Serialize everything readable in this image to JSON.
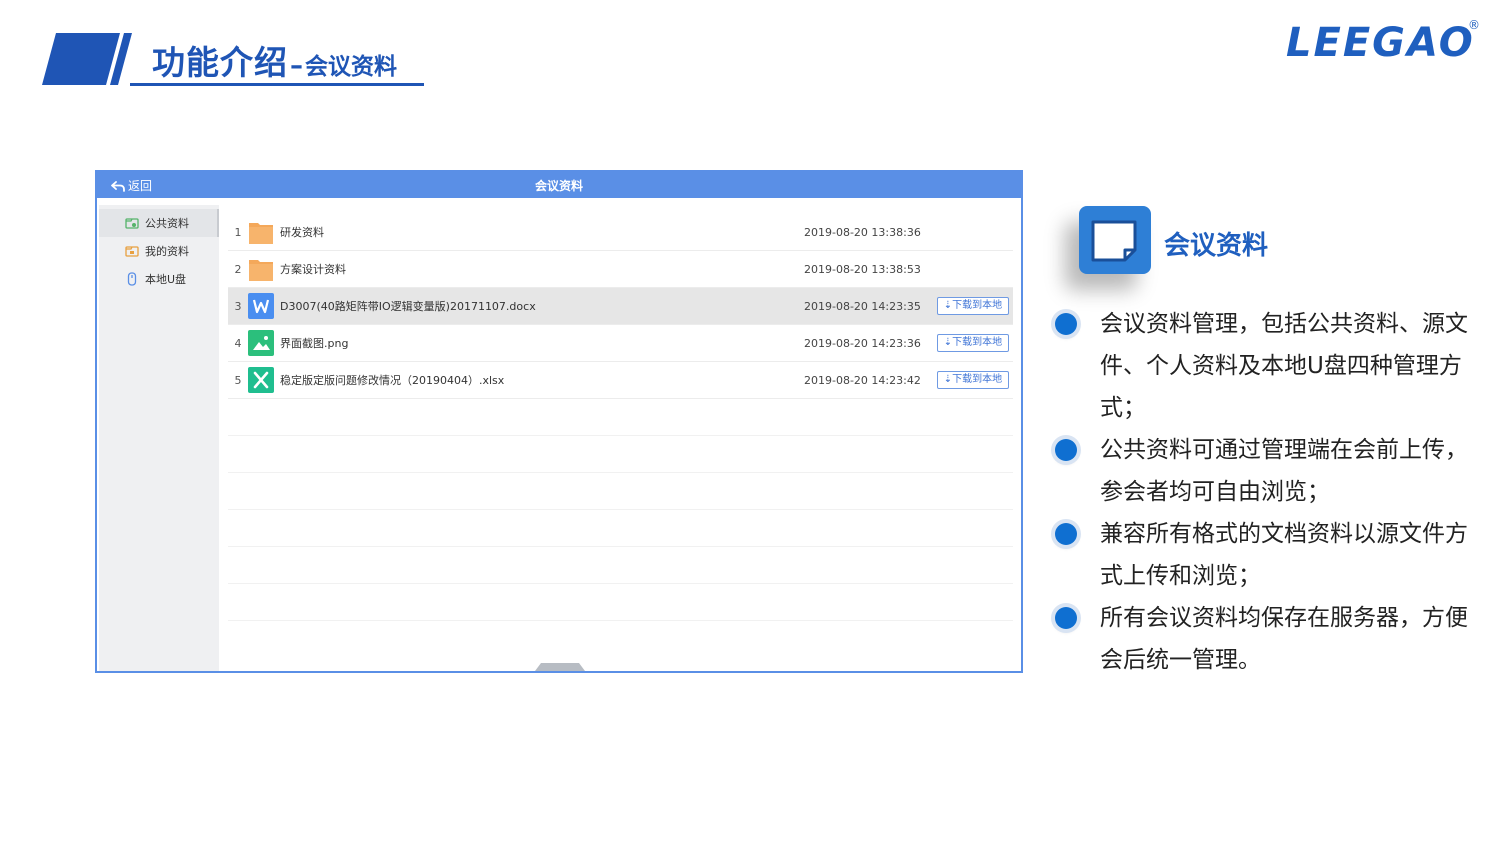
{
  "slide": {
    "title_main": "功能介绍",
    "title_dash": "–",
    "title_sub": "会议资料",
    "logo": "LEEGAO",
    "logo_mark": "®"
  },
  "app": {
    "back_label": "返回",
    "title": "会议资料",
    "sidebar": [
      {
        "label": "公共资料",
        "icon": "public-folder-icon",
        "active": true
      },
      {
        "label": "我的资料",
        "icon": "my-folder-icon",
        "active": false
      },
      {
        "label": "本地U盘",
        "icon": "usb-drive-icon",
        "active": false
      }
    ],
    "files": [
      {
        "num": "1",
        "name": "研发资料",
        "type": "folder",
        "date": "2019-08-20 13:38:36",
        "download": ""
      },
      {
        "num": "2",
        "name": "方案设计资料",
        "type": "folder",
        "date": "2019-08-20 13:38:53",
        "download": ""
      },
      {
        "num": "3",
        "name": "D3007(40路矩阵带IO逻辑变量版)20171107.docx",
        "type": "word",
        "date": "2019-08-20 14:23:35",
        "download": "⇣下载到本地"
      },
      {
        "num": "4",
        "name": "界面截图.png",
        "type": "image",
        "date": "2019-08-20 14:23:36",
        "download": "⇣下载到本地"
      },
      {
        "num": "5",
        "name": "稳定版定版问题修改情况（20190404）.xlsx",
        "type": "excel",
        "date": "2019-08-20 14:23:42",
        "download": "⇣下载到本地"
      }
    ],
    "selected_row": 3
  },
  "feature": {
    "icon": "document-note-icon",
    "title": "会议资料",
    "bullets": [
      "会议资料管理，包括公共资料、源文件、个人资料及本地U盘四种管理方式；",
      "公共资料可通过管理端在会前上传，参会者均可自由浏览；",
      "兼容所有格式的文档资料以源文件方式上传和浏览；",
      "所有会议资料均保存在服务器，方便会后统一管理。"
    ]
  },
  "colors": {
    "brand_blue": "#1f55b5",
    "header_blue": "#5a8fe6",
    "folder_orange": "#f4a85a",
    "word_blue": "#4a8ef0",
    "image_green": "#2bbf7c",
    "excel_teal": "#1fbe8f"
  }
}
